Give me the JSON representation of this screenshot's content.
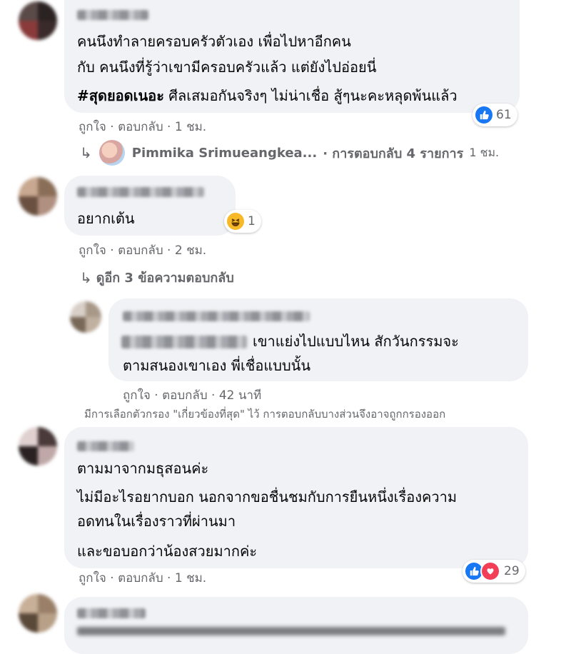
{
  "comments": {
    "c1": {
      "line1": "คนนึงทำลายครอบครัวตัวเอง เพื่อไปหาอีกคน",
      "line2": "กับ คนนึงที่รู้ว่าเขามีครอบครัวแล้ว แต่ยังไปอ่อยนี่",
      "hashtag": "#สุดยอดเนอะ",
      "line3_rest": " ศีลเสมอกันจริงๆ ไม่น่าเชื่อ สู้ๆนะคะหลุดพ้นแล้ว",
      "reaction_count": "61",
      "like_label": "ถูกใจ",
      "reply_label": "ตอบกลับ",
      "time": "1 ชม.",
      "reply_preview_name": "Pimmika Srimueangkea...",
      "reply_preview_summary": "· การตอบกลับ 4 รายการ",
      "reply_preview_time": "1 ชม."
    },
    "c2": {
      "text": "อยากเต้น",
      "reaction_count": "1",
      "like_label": "ถูกใจ",
      "reply_label": "ตอบกลับ",
      "time": "2 ชม.",
      "more_replies": "ดูอีก 3 ข้อความตอบกลับ"
    },
    "c2_reply": {
      "line1": "เขาแย่งไปแบบไหน สักวันกรรมจะ",
      "line2": "ตามสนองเขาเอง พี่เชื่อแบบนั้น",
      "like_label": "ถูกใจ",
      "reply_label": "ตอบกลับ",
      "time": "42 นาที"
    },
    "filter_note": "มีการเลือกตัวกรอง \"เกี่ยวข้องที่สุด\" ไว้ การตอบกลับบางส่วนจึงอาจถูกกรองออก",
    "c3": {
      "line1": "ตามมาจากมธุสอนค่ะ",
      "line2": "ไม่มีอะไรอยากบอก นอกจากขอชื่นชมกับการยืนหนึ่งเรื่องความ",
      "line3": "อดทนในเรื่องราวที่ผ่านมา",
      "line4": "และขอบอกว่าน้องสวยมากค่ะ",
      "reaction_count": "29",
      "like_label": "ถูกใจ",
      "reply_label": "ตอบกลับ",
      "time": "1 ชม."
    }
  },
  "colors": {
    "bubble": "#f0f2f5",
    "meta_text": "#65676b",
    "like_blue": "#1877f2",
    "haha_yellow": "#f7b928",
    "love_red": "#f33e58"
  },
  "icons": {
    "like": "thumbs-up-icon",
    "haha": "laughing-face-icon",
    "love": "heart-icon",
    "reply_arrow": "reply-arrow-icon"
  }
}
